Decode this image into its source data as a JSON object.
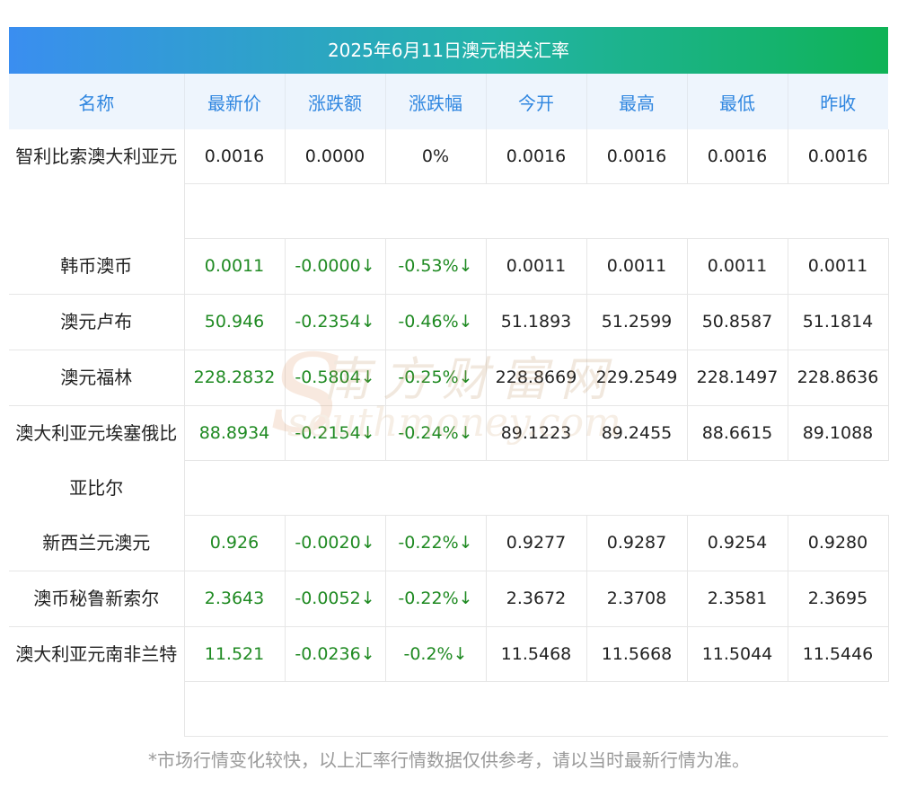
{
  "title": "2025年6月11日澳元相关汇率",
  "headers": [
    "名称",
    "最新价",
    "涨跌额",
    "涨跌幅",
    "今开",
    "最高",
    "最低",
    "昨收"
  ],
  "rows": [
    {
      "name": "智利比索澳大利亚元",
      "latest": "0.0016",
      "change": "0.0000",
      "pct": "0%",
      "open": "0.0016",
      "high": "0.0016",
      "low": "0.0016",
      "prev": "0.0016"
    },
    {
      "name": "韩币澳币",
      "latest": "0.0011",
      "change": "-0.0000↓",
      "pct": "-0.53%↓",
      "open": "0.0011",
      "high": "0.0011",
      "low": "0.0011",
      "prev": "0.0011"
    },
    {
      "name": "澳元卢布",
      "latest": "50.946",
      "change": "-0.2354↓",
      "pct": "-0.46%↓",
      "open": "51.1893",
      "high": "51.2599",
      "low": "50.8587",
      "prev": "51.1814"
    },
    {
      "name": "澳元福林",
      "latest": "228.2832",
      "change": "-0.5804↓",
      "pct": "-0.25%↓",
      "open": "228.8669",
      "high": "229.2549",
      "low": "228.1497",
      "prev": "228.8636"
    },
    {
      "name": "澳大利亚元埃塞俄比亚比尔",
      "latest": "88.8934",
      "change": "-0.2154↓",
      "pct": "-0.24%↓",
      "open": "89.1223",
      "high": "89.2455",
      "low": "88.6615",
      "prev": "89.1088"
    },
    {
      "name": "新西兰元澳元",
      "latest": "0.926",
      "change": "-0.0020↓",
      "pct": "-0.22%↓",
      "open": "0.9277",
      "high": "0.9287",
      "low": "0.9254",
      "prev": "0.9280"
    },
    {
      "name": "澳币秘鲁新索尔",
      "latest": "2.3643",
      "change": "-0.0052↓",
      "pct": "-0.22%↓",
      "open": "2.3672",
      "high": "2.3708",
      "low": "2.3581",
      "prev": "2.3695"
    },
    {
      "name": "澳大利亚元南非兰特",
      "latest": "11.521",
      "change": "-0.0236↓",
      "pct": "-0.2%↓",
      "open": "11.5468",
      "high": "11.5668",
      "low": "11.5044",
      "prev": "11.5446"
    }
  ],
  "footer": "*市场行情变化较快，以上汇率行情数据仅供参考，请以当时最新行情为准。",
  "watermark": {
    "cn": "南方财富网",
    "en": "southmoney.com"
  },
  "colors": {
    "header_text": "#2f86e0",
    "down": "#1f8a22",
    "title_from": "#3a8ef0",
    "title_to": "#0fb356"
  }
}
